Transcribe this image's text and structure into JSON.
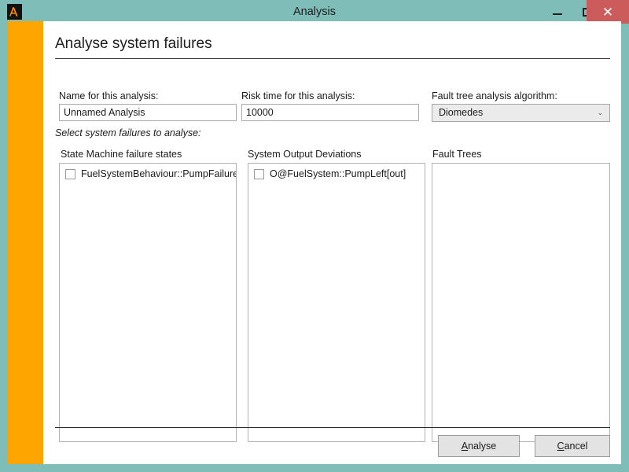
{
  "window": {
    "title": "Analysis",
    "icon": "app-lambda-icon",
    "controls": {
      "minimize": "minimize-icon",
      "maximize": "maximize-icon",
      "close": "✕"
    },
    "colors": {
      "titlebar": "#7fbdb8",
      "accent_bar": "#ffa500",
      "close_button": "#cc5b5b",
      "content": "#ffffff"
    }
  },
  "page": {
    "heading": "Analyse system failures",
    "instruction": "Select system failures to analyse:"
  },
  "fields": {
    "name": {
      "label": "Name for this analysis:",
      "value": "Unnamed Analysis",
      "placeholder": "Unnamed Analysis"
    },
    "risk_time": {
      "label": "Risk time for this analysis:",
      "value": "10000",
      "placeholder": "10000"
    },
    "algorithm": {
      "label": "Fault tree analysis algorithm:",
      "value": "Diomedes",
      "chevron": "⌄"
    }
  },
  "panels": [
    {
      "title": "State Machine failure states",
      "items": [
        {
          "label": "FuelSystemBehaviour::PumpFailure",
          "checked": false
        }
      ]
    },
    {
      "title": "System Output Deviations",
      "items": [
        {
          "label": "O@FuelSystem::PumpLeft[out]",
          "checked": false
        }
      ]
    },
    {
      "title": "Fault Trees",
      "items": []
    }
  ],
  "footer": {
    "analyse": {
      "mnemonic": "A",
      "rest": "nalyse"
    },
    "cancel": {
      "mnemonic": "C",
      "rest": "ancel"
    }
  }
}
